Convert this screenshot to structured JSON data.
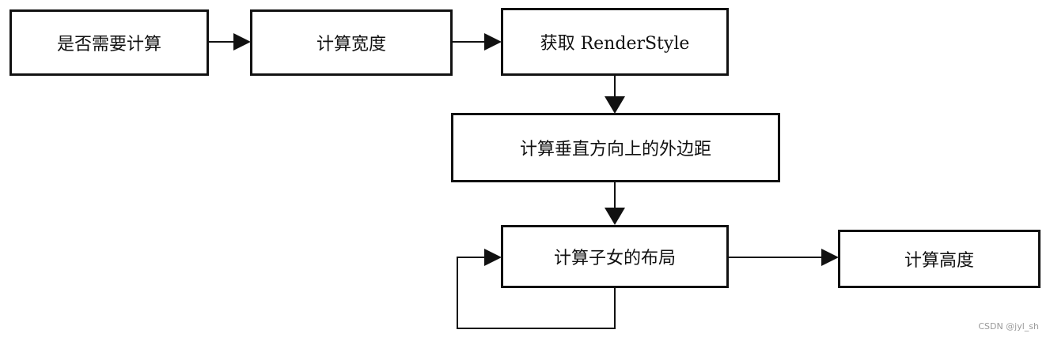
{
  "flow": {
    "step1": "是否需要计算",
    "step2": "计算宽度",
    "step3": "获取 RenderStyle",
    "step4": "计算垂直方向上的外边距",
    "step5": "计算子女的布局",
    "step6": "计算高度"
  },
  "watermark": "CSDN @jyl_sh",
  "colors": {
    "line": "#111111",
    "background": "#ffffff"
  }
}
